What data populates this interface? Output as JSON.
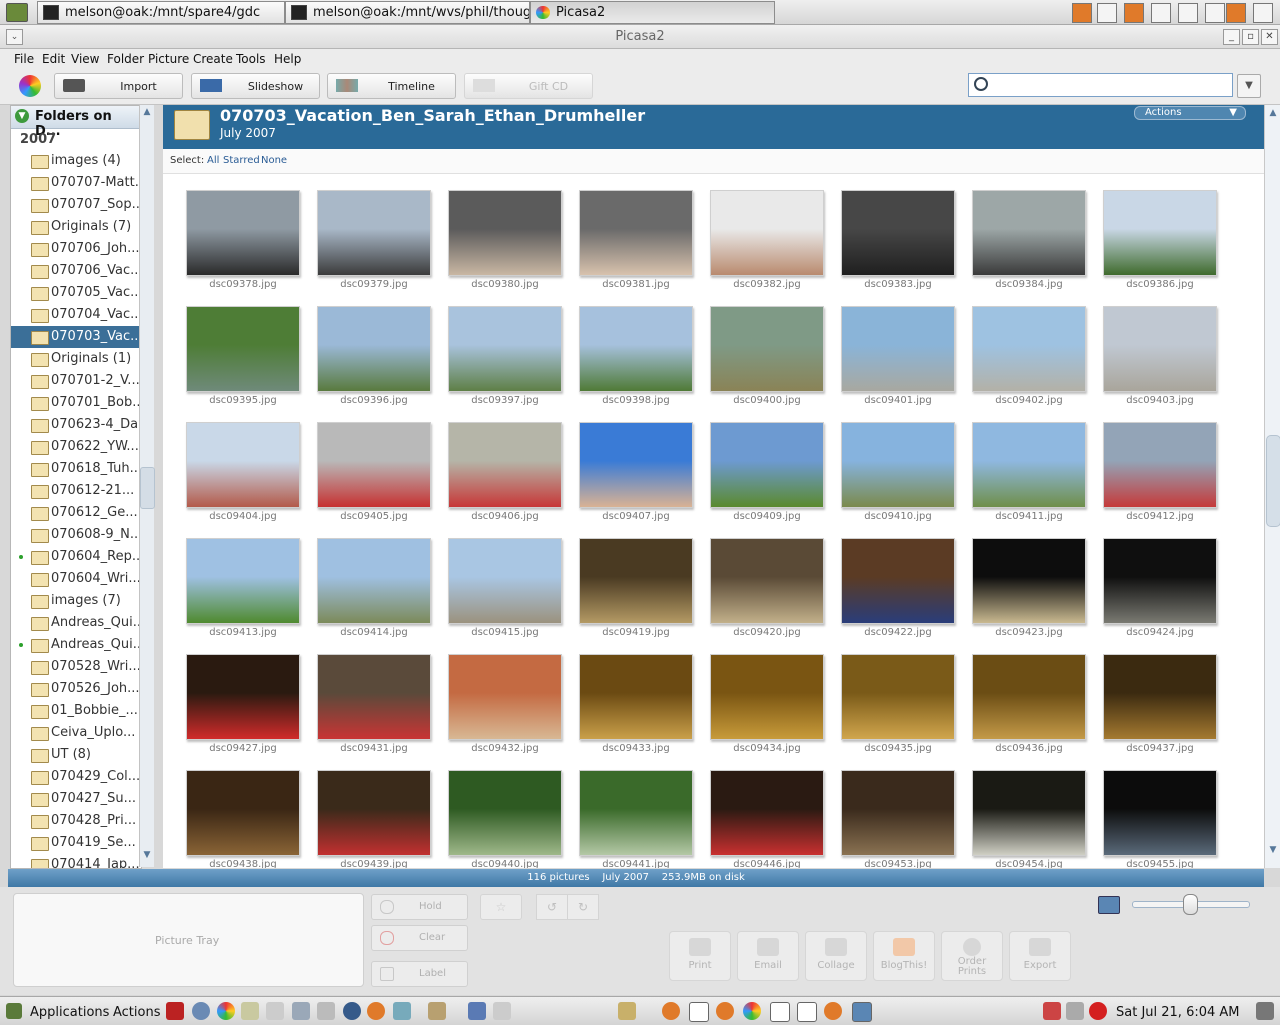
{
  "taskbar_top": {
    "tasks": [
      {
        "label": "melson@oak:/mnt/spare4/gdc"
      },
      {
        "label": "melson@oak:/mnt/wvs/phil/thoughtlet"
      },
      {
        "label": "Picasa2"
      }
    ]
  },
  "window": {
    "title": "Picasa2"
  },
  "menu": {
    "items": [
      "File",
      "Edit",
      "View",
      "Folder",
      "Picture",
      "Create",
      "Tools",
      "Help"
    ]
  },
  "toolbar": {
    "import": "Import",
    "slideshow": "Slideshow",
    "timeline": "Timeline",
    "giftcd": "Gift CD"
  },
  "search": {
    "value": ""
  },
  "sidebar": {
    "header": "Folders on D...",
    "year": "2007",
    "folders": [
      {
        "label": "images (4)",
        "selected": false,
        "dot": false
      },
      {
        "label": "070707-Matt...",
        "selected": false,
        "dot": false
      },
      {
        "label": "070707_Sop...",
        "selected": false,
        "dot": false
      },
      {
        "label": "Originals (7)",
        "selected": false,
        "dot": false
      },
      {
        "label": "070706_Joh...",
        "selected": false,
        "dot": false
      },
      {
        "label": "070706_Vac...",
        "selected": false,
        "dot": false
      },
      {
        "label": "070705_Vac...",
        "selected": false,
        "dot": false
      },
      {
        "label": "070704_Vac...",
        "selected": false,
        "dot": false
      },
      {
        "label": "070703_Vac...",
        "selected": true,
        "dot": false
      },
      {
        "label": "Originals (1)",
        "selected": false,
        "dot": false
      },
      {
        "label": "070701-2_V...",
        "selected": false,
        "dot": false
      },
      {
        "label": "070701_Bob...",
        "selected": false,
        "dot": false
      },
      {
        "label": "070623-4_Da...",
        "selected": false,
        "dot": false
      },
      {
        "label": "070622_YW...",
        "selected": false,
        "dot": false
      },
      {
        "label": "070618_Tuh...",
        "selected": false,
        "dot": false
      },
      {
        "label": "070612-21...",
        "selected": false,
        "dot": false
      },
      {
        "label": "070612_Ge...",
        "selected": false,
        "dot": false
      },
      {
        "label": "070608-9_N...",
        "selected": false,
        "dot": false
      },
      {
        "label": "070604_Rep...",
        "selected": false,
        "dot": true
      },
      {
        "label": "070604_Wri...",
        "selected": false,
        "dot": false
      },
      {
        "label": "images (7)",
        "selected": false,
        "dot": false
      },
      {
        "label": "Andreas_Qui...",
        "selected": false,
        "dot": false
      },
      {
        "label": "Andreas_Qui...",
        "selected": false,
        "dot": true
      },
      {
        "label": "070528_Wri...",
        "selected": false,
        "dot": false
      },
      {
        "label": "070526_Joh...",
        "selected": false,
        "dot": false
      },
      {
        "label": "01_Bobbie_...",
        "selected": false,
        "dot": false
      },
      {
        "label": "Ceiva_Uplo...",
        "selected": false,
        "dot": false
      },
      {
        "label": "UT (8)",
        "selected": false,
        "dot": false
      },
      {
        "label": "070429_Col...",
        "selected": false,
        "dot": false
      },
      {
        "label": "070427_Su...",
        "selected": false,
        "dot": false
      },
      {
        "label": "070428_Pri...",
        "selected": false,
        "dot": false
      },
      {
        "label": "070419_Se...",
        "selected": false,
        "dot": false
      },
      {
        "label": "070414_Jap...",
        "selected": false,
        "dot": false
      }
    ]
  },
  "album": {
    "title": "070703_Vacation_Ben_Sarah_Ethan_Drumheller",
    "date": "July 2007",
    "actions_label": "Actions",
    "select_label": "Select:",
    "select_links": [
      "All",
      "Starred",
      "None"
    ]
  },
  "photos": [
    {
      "name": "dsc09378.jpg",
      "colors": [
        "#8f9aa3",
        "#2a2a2a"
      ]
    },
    {
      "name": "dsc09379.jpg",
      "colors": [
        "#a9b8c8",
        "#3b3b3b"
      ]
    },
    {
      "name": "dsc09380.jpg",
      "colors": [
        "#5b5b5b",
        "#c9b7a3"
      ]
    },
    {
      "name": "dsc09381.jpg",
      "colors": [
        "#6a6a6a",
        "#d8c2ad"
      ]
    },
    {
      "name": "dsc09382.jpg",
      "colors": [
        "#e9e9e9",
        "#b98a6e"
      ]
    },
    {
      "name": "dsc09383.jpg",
      "colors": [
        "#474747",
        "#1f1f1f"
      ]
    },
    {
      "name": "dsc09384.jpg",
      "colors": [
        "#9da7a7",
        "#3a3a3a"
      ]
    },
    {
      "name": "dsc09386.jpg",
      "colors": [
        "#c9d7e6",
        "#3f6b2d"
      ]
    },
    {
      "name": "dsc09395.jpg",
      "colors": [
        "#4e7d36",
        "#6f8a7a"
      ]
    },
    {
      "name": "dsc09396.jpg",
      "colors": [
        "#9bb9d7",
        "#597a3e"
      ]
    },
    {
      "name": "dsc09397.jpg",
      "colors": [
        "#a9c3dd",
        "#5e7f46"
      ]
    },
    {
      "name": "dsc09398.jpg",
      "colors": [
        "#a6c1dd",
        "#4f7a36"
      ]
    },
    {
      "name": "dsc09400.jpg",
      "colors": [
        "#7f9a86",
        "#8a8356"
      ]
    },
    {
      "name": "dsc09401.jpg",
      "colors": [
        "#8ab4d8",
        "#a8a8a0"
      ]
    },
    {
      "name": "dsc09402.jpg",
      "colors": [
        "#9ec2e1",
        "#b3b1a7"
      ]
    },
    {
      "name": "dsc09403.jpg",
      "colors": [
        "#c0c8d2",
        "#a9a59b"
      ]
    },
    {
      "name": "dsc09404.jpg",
      "colors": [
        "#c9d8e8",
        "#b35a4a"
      ]
    },
    {
      "name": "dsc09405.jpg",
      "colors": [
        "#b9b9b9",
        "#c63131"
      ]
    },
    {
      "name": "dsc09406.jpg",
      "colors": [
        "#b5b5a8",
        "#c73737"
      ]
    },
    {
      "name": "dsc09407.jpg",
      "colors": [
        "#3a7bd6",
        "#d9b294"
      ]
    },
    {
      "name": "dsc09409.jpg",
      "colors": [
        "#6d9ad1",
        "#5b8a2e"
      ]
    },
    {
      "name": "dsc09410.jpg",
      "colors": [
        "#86b3de",
        "#7b8a4c"
      ]
    },
    {
      "name": "dsc09411.jpg",
      "colors": [
        "#8fb8e0",
        "#6f8f4a"
      ]
    },
    {
      "name": "dsc09412.jpg",
      "colors": [
        "#93a4b7",
        "#c53a3a"
      ]
    },
    {
      "name": "dsc09413.jpg",
      "colors": [
        "#9fc1e3",
        "#4f8a2f"
      ]
    },
    {
      "name": "dsc09414.jpg",
      "colors": [
        "#9fc0e1",
        "#7c8a5a"
      ]
    },
    {
      "name": "dsc09415.jpg",
      "colors": [
        "#a9c6e3",
        "#9b927e"
      ]
    },
    {
      "name": "dsc09419.jpg",
      "colors": [
        "#4a3a22",
        "#b49a64"
      ]
    },
    {
      "name": "dsc09420.jpg",
      "colors": [
        "#5a4a36",
        "#c2b08a"
      ]
    },
    {
      "name": "dsc09422.jpg",
      "colors": [
        "#5b3b24",
        "#2a3d7a"
      ]
    },
    {
      "name": "dsc09423.jpg",
      "colors": [
        "#0d0d0d",
        "#c9b990"
      ]
    },
    {
      "name": "dsc09424.jpg",
      "colors": [
        "#0f0f0f",
        "#7a7a72"
      ]
    },
    {
      "name": "dsc09427.jpg",
      "colors": [
        "#2a1a10",
        "#d12b2b"
      ]
    },
    {
      "name": "dsc09431.jpg",
      "colors": [
        "#5a4a3a",
        "#c93535"
      ]
    },
    {
      "name": "dsc09432.jpg",
      "colors": [
        "#c46a42",
        "#d8b894"
      ]
    },
    {
      "name": "dsc09433.jpg",
      "colors": [
        "#6b4a12",
        "#caa04a"
      ]
    },
    {
      "name": "dsc09434.jpg",
      "colors": [
        "#7a5512",
        "#c89b3a"
      ]
    },
    {
      "name": "dsc09435.jpg",
      "colors": [
        "#7a5a18",
        "#d1a64d"
      ]
    },
    {
      "name": "dsc09436.jpg",
      "colors": [
        "#6b4d14",
        "#c49a48"
      ]
    },
    {
      "name": "dsc09437.jpg",
      "colors": [
        "#3b2a10",
        "#a57a30"
      ]
    },
    {
      "name": "dsc09438.jpg",
      "colors": [
        "#3a2614",
        "#8a6436"
      ]
    },
    {
      "name": "dsc09439.jpg",
      "colors": [
        "#3a2a1a",
        "#c23030"
      ]
    },
    {
      "name": "dsc09440.jpg",
      "colors": [
        "#2e5a22",
        "#9fb88a"
      ]
    },
    {
      "name": "dsc09441.jpg",
      "colors": [
        "#3a6a2a",
        "#b4c8a6"
      ]
    },
    {
      "name": "dsc09446.jpg",
      "colors": [
        "#2a1a12",
        "#c93030"
      ]
    },
    {
      "name": "dsc09453.jpg",
      "colors": [
        "#3a2a1c",
        "#8a7252"
      ]
    },
    {
      "name": "dsc09454.jpg",
      "colors": [
        "#1a1a14",
        "#cfcfc4"
      ]
    },
    {
      "name": "dsc09455.jpg",
      "colors": [
        "#0c0c0c",
        "#5a6a7a"
      ]
    }
  ],
  "statusbar": {
    "pictures": "116 pictures",
    "date": "July 2007",
    "size": "253.9MB on disk"
  },
  "tray": {
    "label": "Picture Tray",
    "hold": "Hold",
    "clear": "Clear",
    "label_btn": "Label",
    "actions": [
      "Print",
      "Email",
      "Collage",
      "BlogThis!",
      "Order Prints",
      "Export"
    ]
  },
  "bottom_panel": {
    "applications": "Applications",
    "actions": "Actions",
    "clock": "Sat Jul 21,  6:04 AM"
  }
}
